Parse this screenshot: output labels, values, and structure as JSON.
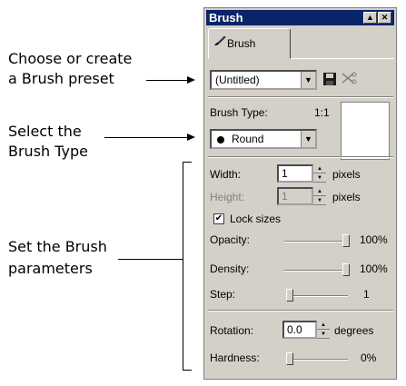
{
  "callouts": {
    "preset_line1": "Choose or create",
    "preset_line2": "a Brush preset",
    "type_line1": "Select the",
    "type_line2": "Brush Type",
    "params_line1": "Set the Brush",
    "params_line2": "parameters"
  },
  "window": {
    "title": "Brush",
    "minimize_glyph": "▲",
    "close_glyph": "✕"
  },
  "tab": {
    "label": "Brush"
  },
  "preset": {
    "value": "(Untitled)",
    "save_icon": "save-icon",
    "delete_icon": "scissors-icon"
  },
  "brush_type": {
    "label": "Brush Type:",
    "ratio": "1:1",
    "value": "Round"
  },
  "width": {
    "label": "Width:",
    "value": "1",
    "unit": "pixels"
  },
  "height": {
    "label": "Height:",
    "value": "1",
    "unit": "pixels"
  },
  "lock_sizes": {
    "label": "Lock sizes",
    "checked": true
  },
  "opacity": {
    "label": "Opacity:",
    "value": "100%",
    "level": 1.0
  },
  "density": {
    "label": "Density:",
    "value": "100%",
    "level": 1.0
  },
  "step": {
    "label": "Step:",
    "value": "1",
    "level": 0.0
  },
  "rotation": {
    "label": "Rotation:",
    "value": "0.0",
    "unit": "degrees"
  },
  "hardness": {
    "label": "Hardness:",
    "value": "0%",
    "level": 0.0
  },
  "colors": {
    "titlebar": "#0a246a",
    "face": "#d4d0c8"
  }
}
